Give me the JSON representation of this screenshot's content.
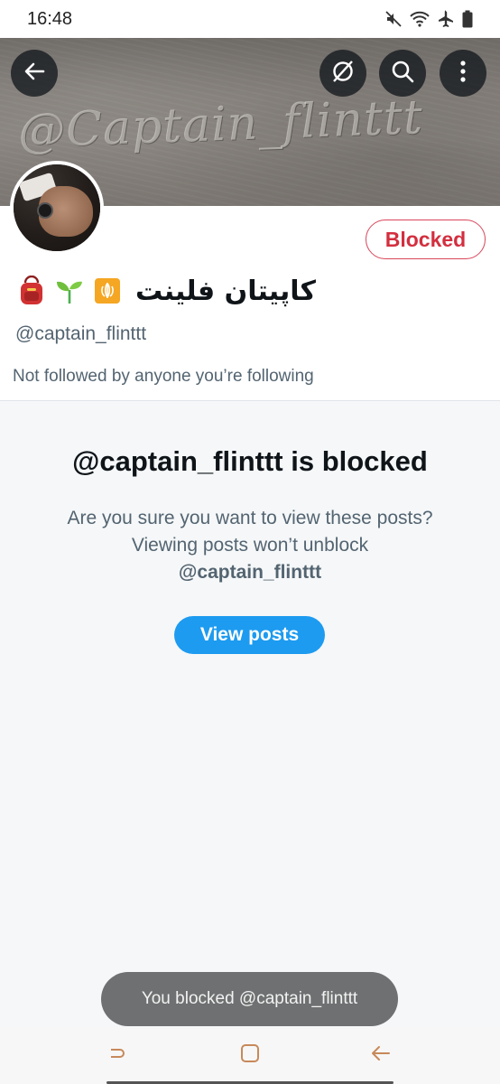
{
  "status_bar": {
    "time": "16:48",
    "icons": [
      "mute-icon",
      "wifi-icon",
      "airplane-icon",
      "battery-icon"
    ]
  },
  "header": {
    "banner_writing": "@Captain_flinttt",
    "buttons": [
      "back-arrow-icon",
      "translate-icon",
      "search-icon",
      "more-vertical-icon"
    ]
  },
  "profile": {
    "blocked_label": "Blocked",
    "display_name": "کاپیتان فلینت",
    "emoji": [
      "backpack-emoji",
      "seedling-emoji",
      "iran-emblem-emoji"
    ],
    "handle": "@captain_flinttt",
    "followed_info": "Not followed by anyone you’re following"
  },
  "blocked_notice": {
    "title": "@captain_flinttt is blocked",
    "description": "Are you sure you want to view these posts? Viewing posts won’t unblock",
    "description_handle": "@captain_flinttt",
    "view_posts_label": "View posts"
  },
  "toast": {
    "message": "You blocked @captain_flinttt"
  },
  "navbar": {
    "buttons": [
      "recents-icon",
      "home-icon",
      "back-icon"
    ]
  },
  "colors": {
    "accent_blue": "#1d9bf0",
    "blocked_red": "#d32f3f",
    "secondary_text": "#536471"
  }
}
